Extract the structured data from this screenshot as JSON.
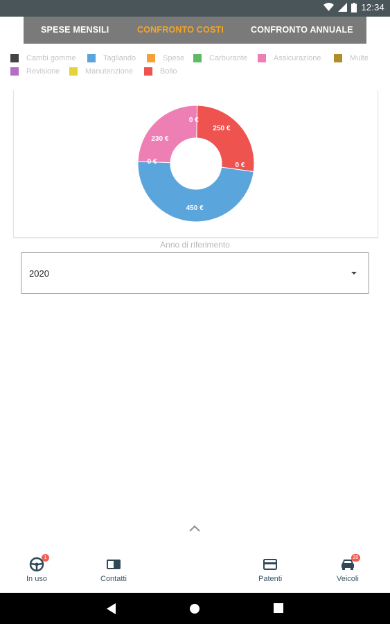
{
  "status_bar": {
    "time": "12:34",
    "icons": [
      "wifi-icon",
      "signal-icon",
      "battery-icon"
    ]
  },
  "tabs": [
    {
      "label": "SPESE MENSILI",
      "active": false
    },
    {
      "label": "CONFRONTO COSTI",
      "active": true
    },
    {
      "label": "CONFRONTO ANNUALE",
      "active": false
    }
  ],
  "legend": [
    {
      "label": "Cambi gomme",
      "color": "#444444"
    },
    {
      "label": "Tagliando",
      "color": "#5aa5dc"
    },
    {
      "label": "Spese",
      "color": "#f5a13a"
    },
    {
      "label": "Carburante",
      "color": "#5dbb63"
    },
    {
      "label": "Assicurazione",
      "color": "#ee7fb5"
    },
    {
      "label": "Multe",
      "color": "#b08d2a"
    },
    {
      "label": "Revisione",
      "color": "#b56fc2"
    },
    {
      "label": "Manutenzione",
      "color": "#e6d23a"
    },
    {
      "label": "Bollo",
      "color": "#ef5350"
    }
  ],
  "chart_data": {
    "type": "pie",
    "style": "donut",
    "labels": [
      "Bollo",
      "Tagliando",
      "Assicurazione",
      "Spese"
    ],
    "values": [
      250,
      450,
      230,
      0
    ],
    "colors": [
      "#ef5350",
      "#5aa5dc",
      "#ee7fb5",
      "#f5a13a"
    ],
    "data_labels": [
      "250 €",
      "450 €",
      "230 €",
      "0 €",
      "0 €",
      "0 €"
    ]
  },
  "year_selector": {
    "label": "Anno di riferimento",
    "value": "2020"
  },
  "bottom_nav": [
    {
      "label": "In uso",
      "icon": "steering-wheel-icon",
      "badge": "1"
    },
    {
      "label": "Contatti",
      "icon": "contacts-icon",
      "badge": ""
    },
    {
      "label": "Patenti",
      "icon": "license-card-icon",
      "badge": ""
    },
    {
      "label": "Veicoli",
      "icon": "car-icon",
      "badge": "20"
    }
  ],
  "system_nav": [
    "back-icon",
    "home-icon",
    "recents-icon"
  ]
}
